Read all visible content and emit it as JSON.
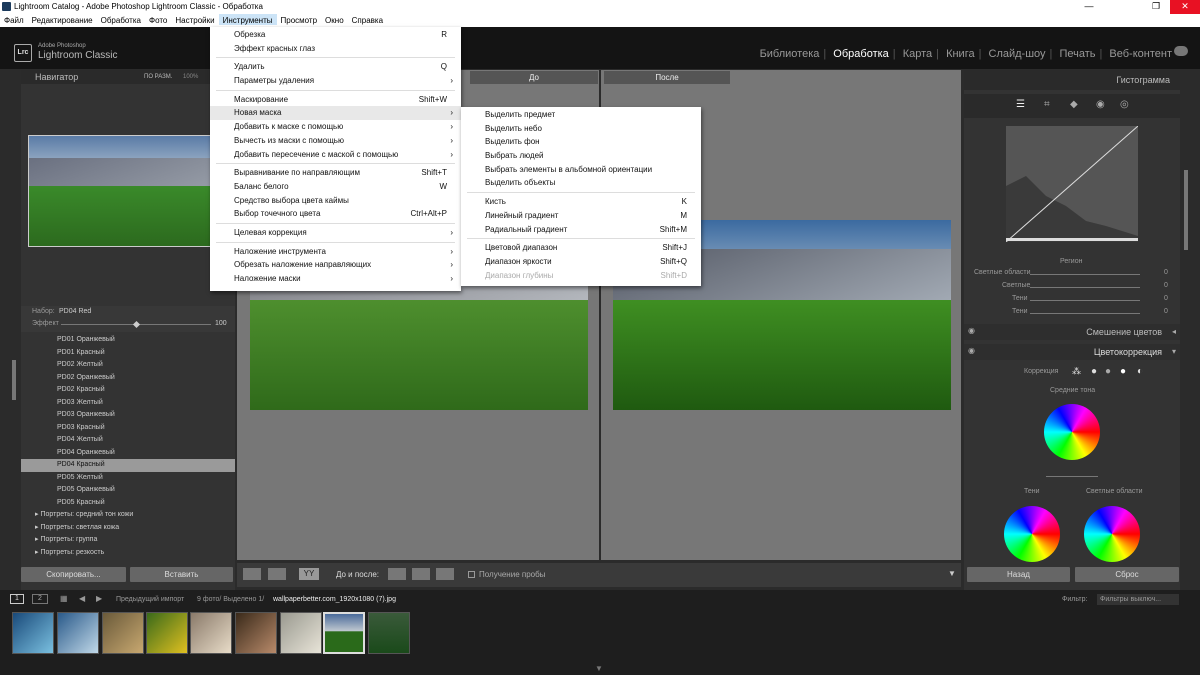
{
  "window": {
    "title": "Lightroom Catalog - Adobe Photoshop Lightroom Classic - Обработка",
    "minimize": "—",
    "maximize": "❐",
    "close": "✕"
  },
  "menubar": [
    "Файл",
    "Редактирование",
    "Обработка",
    "Фото",
    "Настройки",
    "Инструменты",
    "Просмотр",
    "Окно",
    "Справка"
  ],
  "brand": {
    "logo": "Lrc",
    "line1": "Adobe Photoshop",
    "line2": "Lightroom Classic"
  },
  "modules": [
    "Библиотека",
    "Обработка",
    "Карта",
    "Книга",
    "Слайд-шоу",
    "Печать",
    "Веб-контент"
  ],
  "left": {
    "navigator": "Навигатор",
    "nav_opts": "ПО РАЗМ.",
    "nav_zoom": "100%",
    "preset_label": "Набор:",
    "preset_value": "PD04 Red",
    "effect_label": "Эффект",
    "effect_value": "100",
    "effect_level": 0.5,
    "items": [
      "PD01 Оранжевый",
      "PD01 Красный",
      "PD02 Желтый",
      "PD02 Оранжевый",
      "PD02 Красный",
      "PD03 Желтый",
      "PD03 Оранжевый",
      "PD03 Красный",
      "PD04 Желтый",
      "PD04 Оранжевый",
      "PD04 Красный",
      "PD05 Желтый",
      "PD05 Оранжевый",
      "PD05 Красный"
    ],
    "selected_index": 10,
    "groups": [
      "Портреты: средний тон кожи",
      "Портреты: светлая кожа",
      "Портреты: группа",
      "Портреты: резкость"
    ],
    "copy_btn": "Скопировать...",
    "paste_btn": "Вставить"
  },
  "center": {
    "before": "До",
    "after": "После",
    "toolbar_label": "До и после:",
    "probe": "Получение пробы"
  },
  "right": {
    "histogram": "Гистограмма",
    "region": "Регион",
    "sliders": [
      {
        "label": "Светлые области",
        "value": "0"
      },
      {
        "label": "Светлые",
        "value": "0"
      },
      {
        "label": "Тени",
        "value": "0"
      },
      {
        "label": "Тени",
        "value": "0"
      }
    ],
    "mix": "Смешение цветов",
    "grading": "Цветокоррекция",
    "correction": "Коррекция",
    "midtones": "Средние тона",
    "shadows": "Тени",
    "highlights": "Светлые области",
    "back_btn": "Назад",
    "reset_btn": "Сброс"
  },
  "filmstrip": {
    "page1": "1",
    "page2": "2",
    "source": "Предыдущий импорт",
    "count": "9 фото/ Выделено 1/",
    "file": "wallpaperbetter.com_1920x1080 (7).jpg",
    "filter_label": "Фильтр:",
    "filter_value": "Фильтры выключ..."
  },
  "menu1": [
    {
      "label": "Обрезка",
      "sc": "R"
    },
    {
      "label": "Эффект красных глаз",
      "sc": ""
    },
    {
      "sep": true
    },
    {
      "label": "Удалить",
      "sc": "Q"
    },
    {
      "label": "Параметры удаления",
      "sc": "",
      "arrow": true
    },
    {
      "sep": true
    },
    {
      "label": "Маскирование",
      "sc": "Shift+W"
    },
    {
      "label": "Новая маска",
      "sc": "",
      "arrow": true,
      "hl": true
    },
    {
      "label": "Добавить к маске с помощью",
      "sc": "",
      "arrow": true
    },
    {
      "label": "Вычесть из маски с помощью",
      "sc": "",
      "arrow": true
    },
    {
      "label": "Добавить пересечение с маской с помощью",
      "sc": "",
      "arrow": true
    },
    {
      "sep": true
    },
    {
      "label": "Выравнивание по направляющим",
      "sc": "Shift+T"
    },
    {
      "label": "Баланс белого",
      "sc": "W"
    },
    {
      "label": "Средство выбора цвета каймы",
      "sc": ""
    },
    {
      "label": "Выбор точечного цвета",
      "sc": "Ctrl+Alt+P"
    },
    {
      "sep": true
    },
    {
      "label": "Целевая коррекция",
      "sc": "",
      "arrow": true
    },
    {
      "sep": true
    },
    {
      "label": "Наложение инструмента",
      "sc": "",
      "arrow": true
    },
    {
      "label": "Обрезать наложение направляющих",
      "sc": "",
      "arrow": true
    },
    {
      "label": "Наложение маски",
      "sc": "",
      "arrow": true
    }
  ],
  "menu2": [
    {
      "label": "Выделить предмет",
      "sc": ""
    },
    {
      "label": "Выделить небо",
      "sc": ""
    },
    {
      "label": "Выделить фон",
      "sc": ""
    },
    {
      "label": "Выбрать людей",
      "sc": ""
    },
    {
      "label": "Выбрать элементы в альбомной ориентации",
      "sc": ""
    },
    {
      "label": "Выделить объекты",
      "sc": ""
    },
    {
      "sep": true
    },
    {
      "label": "Кисть",
      "sc": "K"
    },
    {
      "label": "Линейный градиент",
      "sc": "M"
    },
    {
      "label": "Радиальный градиент",
      "sc": "Shift+M"
    },
    {
      "sep": true
    },
    {
      "label": "Цветовой диапазон",
      "sc": "Shift+J"
    },
    {
      "label": "Диапазон яркости",
      "sc": "Shift+Q"
    },
    {
      "label": "Диапазон глубины",
      "sc": "Shift+D",
      "dis": true
    }
  ],
  "colors": {
    "accent": "#ffffff",
    "panel": "#333333",
    "selected": "#9a9a9a"
  }
}
